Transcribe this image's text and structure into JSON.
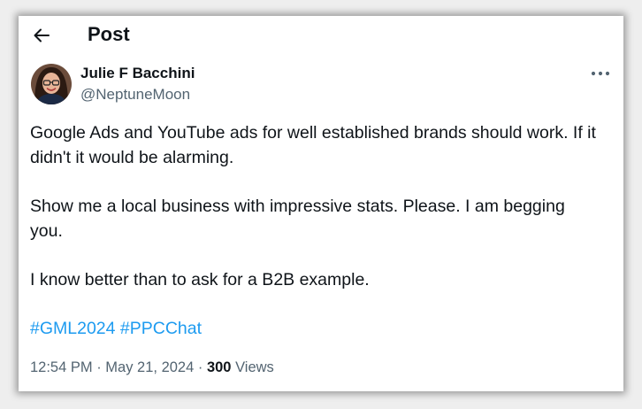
{
  "header": {
    "title": "Post",
    "back_icon": "arrow-left-icon"
  },
  "author": {
    "name": "Julie F Bacchini",
    "handle": "@NeptuneMoon"
  },
  "post": {
    "paragraphs": [
      "Google Ads and YouTube ads for well established brands should work. If it didn't it would be alarming.",
      "Show me a local business with impressive stats. Please. I am begging you.",
      "I know better than to ask for a B2B example."
    ],
    "hashtags": [
      "#GML2024",
      "#PPCChat"
    ]
  },
  "meta": {
    "time": "12:54 PM",
    "separator": " · ",
    "date": "May 21, 2024",
    "views_count": "300",
    "views_label": " Views"
  },
  "colors": {
    "text": "#0f1419",
    "secondary": "#536471",
    "link": "#1d9bf0"
  }
}
